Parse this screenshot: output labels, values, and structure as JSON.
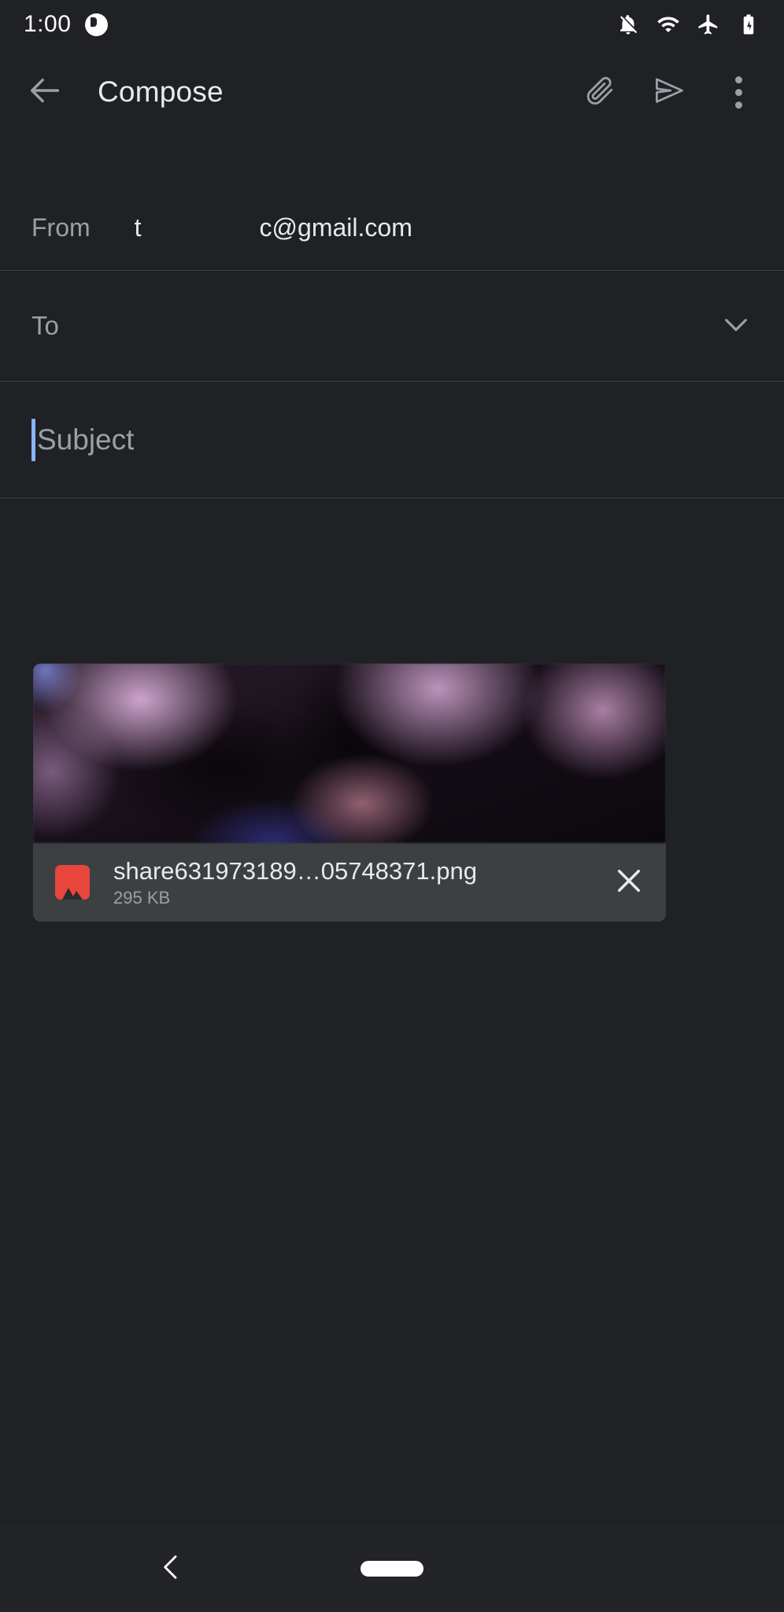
{
  "status_bar": {
    "time": "1:00",
    "badge_icon": "notification-badge-icon",
    "icons": [
      "notifications-off-icon",
      "wifi-icon",
      "airplane-mode-icon",
      "battery-charging-icon"
    ]
  },
  "app_bar": {
    "back_icon": "back-arrow-icon",
    "title": "Compose",
    "attach_icon": "attach-file-icon",
    "send_icon": "send-icon",
    "overflow_icon": "more-options-icon"
  },
  "compose": {
    "from_label": "From",
    "from_prefix": "t",
    "from_suffix": "c@gmail.com",
    "to_placeholder": "To",
    "to_expand_icon": "chevron-down-icon",
    "subject_placeholder": "Subject",
    "body_placeholder": ""
  },
  "attachment": {
    "file_icon": "image-file-icon",
    "filename": "share631973189…05748371.png",
    "filesize": "295 KB",
    "remove_icon": "close-icon"
  },
  "nav_bar": {
    "back_icon": "nav-back-icon",
    "home_pill": "home-pill-indicator"
  },
  "colors": {
    "background": "#202124",
    "surface": "#3c4043",
    "divider": "#3c4043",
    "text_primary": "#e8eaed",
    "text_secondary": "#9aa0a6",
    "accent_caret": "#8ab4f8",
    "file_icon": "#E8453C",
    "nav_background": "#232428"
  }
}
